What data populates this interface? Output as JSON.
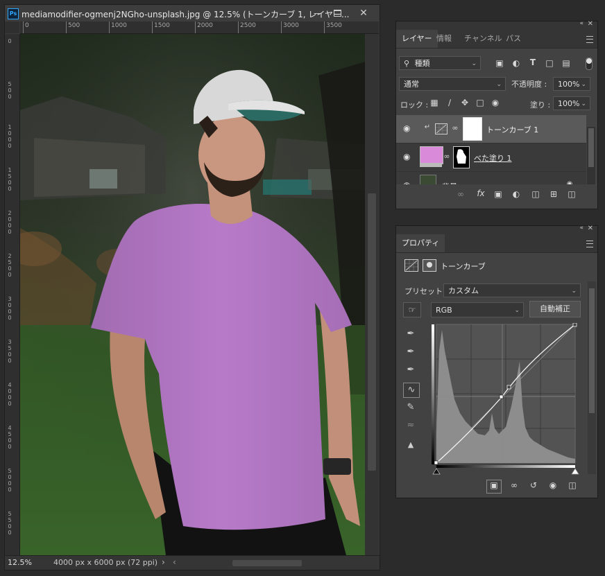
{
  "document": {
    "title": "mediamodifier-ogmenj2NGho-unsplash.jpg @ 12.5% (トーンカーブ 1, レイヤー...",
    "app_icon": "Ps",
    "ruler_top_labels": [
      "0",
      "500",
      "1000",
      "1500",
      "2000",
      "2500",
      "3000",
      "3500"
    ],
    "ruler_left_labels": [
      "0",
      "500",
      "1000",
      "1500",
      "2000",
      "2500",
      "3000",
      "3500",
      "4000",
      "4500",
      "5000",
      "5500"
    ],
    "zoom": "12.5%",
    "doc_size": "4000 px x 6000 px (72 ppi)",
    "scroll_arrow": "›",
    "scroll_left_arrow": "‹",
    "tshirt_color": "#b77ac9"
  },
  "layers_panel": {
    "tabs": [
      "レイヤー",
      "情報",
      "チャンネル",
      "パス"
    ],
    "filter_label": "種類",
    "blend_mode": "通常",
    "opacity_label": "不透明度 :",
    "opacity_value": "100%",
    "lock_label": "ロック :",
    "fill_label": "塗り :",
    "fill_value": "100%",
    "layers": [
      {
        "name": "トーンカーブ 1",
        "selected": true
      },
      {
        "name": "べた塗り 1",
        "selected": false
      },
      {
        "name": "背景",
        "selected": false
      }
    ],
    "fill_swatch": "#d98ad9",
    "fx_label": "fx"
  },
  "properties_panel": {
    "tab": "プロパティ",
    "title": "トーンカーブ",
    "preset_label": "プリセット :",
    "preset_value": "カスタム",
    "channel": "RGB",
    "auto_button": "自動補正"
  }
}
